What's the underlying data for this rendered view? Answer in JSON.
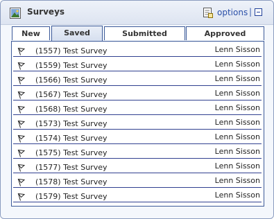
{
  "header": {
    "title": "Surveys",
    "options_label": "options",
    "separator": "|",
    "title_icon": "image-icon",
    "options_icon": "options-icon",
    "collapse_icon": "minimize-icon"
  },
  "tabs": [
    {
      "label": "New"
    },
    {
      "label": "Saved",
      "active": true
    },
    {
      "label": "Submitted"
    },
    {
      "label": "Approved"
    }
  ],
  "surveys": [
    {
      "name": "(1557) Test Survey",
      "owner": "Lenn Sisson"
    },
    {
      "name": "(1559) Test Survey",
      "owner": "Lenn Sisson"
    },
    {
      "name": "(1566) Test Survey",
      "owner": "Lenn Sisson"
    },
    {
      "name": "(1567) Test Survey",
      "owner": "Lenn Sisson"
    },
    {
      "name": "(1568) Test Survey",
      "owner": "Lenn Sisson"
    },
    {
      "name": "(1573) Test Survey",
      "owner": "Lenn Sisson"
    },
    {
      "name": "(1574) Test Survey",
      "owner": "Lenn Sisson"
    },
    {
      "name": "(1575) Test Survey",
      "owner": "Lenn Sisson"
    },
    {
      "name": "(1577) Test Survey",
      "owner": "Lenn Sisson"
    },
    {
      "name": "(1578) Test Survey",
      "owner": "Lenn Sisson"
    },
    {
      "name": "(1579) Test Survey",
      "owner": "Lenn Sisson"
    }
  ],
  "colors": {
    "header_bg": "#dde4f1",
    "border": "#3b5998",
    "link": "#2a4fa8"
  }
}
